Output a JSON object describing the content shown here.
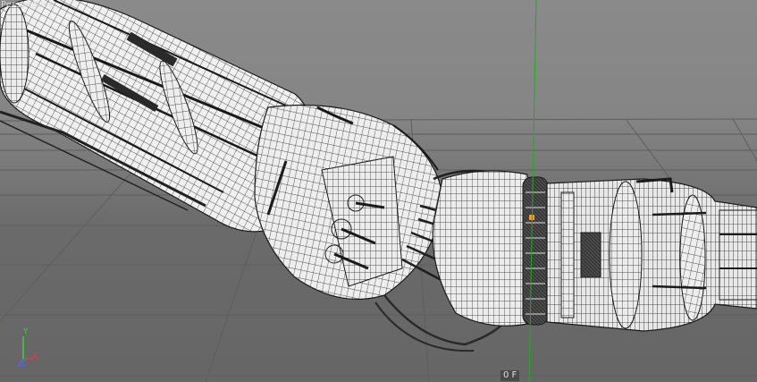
{
  "viewport": {
    "view_name": "Perspective",
    "frame": "0 F",
    "background_top": "#8a8a8a",
    "background_bottom": "#666666",
    "grid_color": "#5a5a5a",
    "y_axis_color": "#22aa22"
  },
  "axis_gizmo": {
    "y_label": "Y",
    "x_label": "X",
    "z_label": "Z",
    "x_color": "#e04040",
    "y_color": "#3ccf3c",
    "z_color": "#4a6ae8"
  },
  "model": {
    "description_icon": "mechanical-arm-wireframe",
    "fill": "#f2f2f2",
    "wire": "#1a1a1a",
    "highlight": "#f0a020"
  }
}
